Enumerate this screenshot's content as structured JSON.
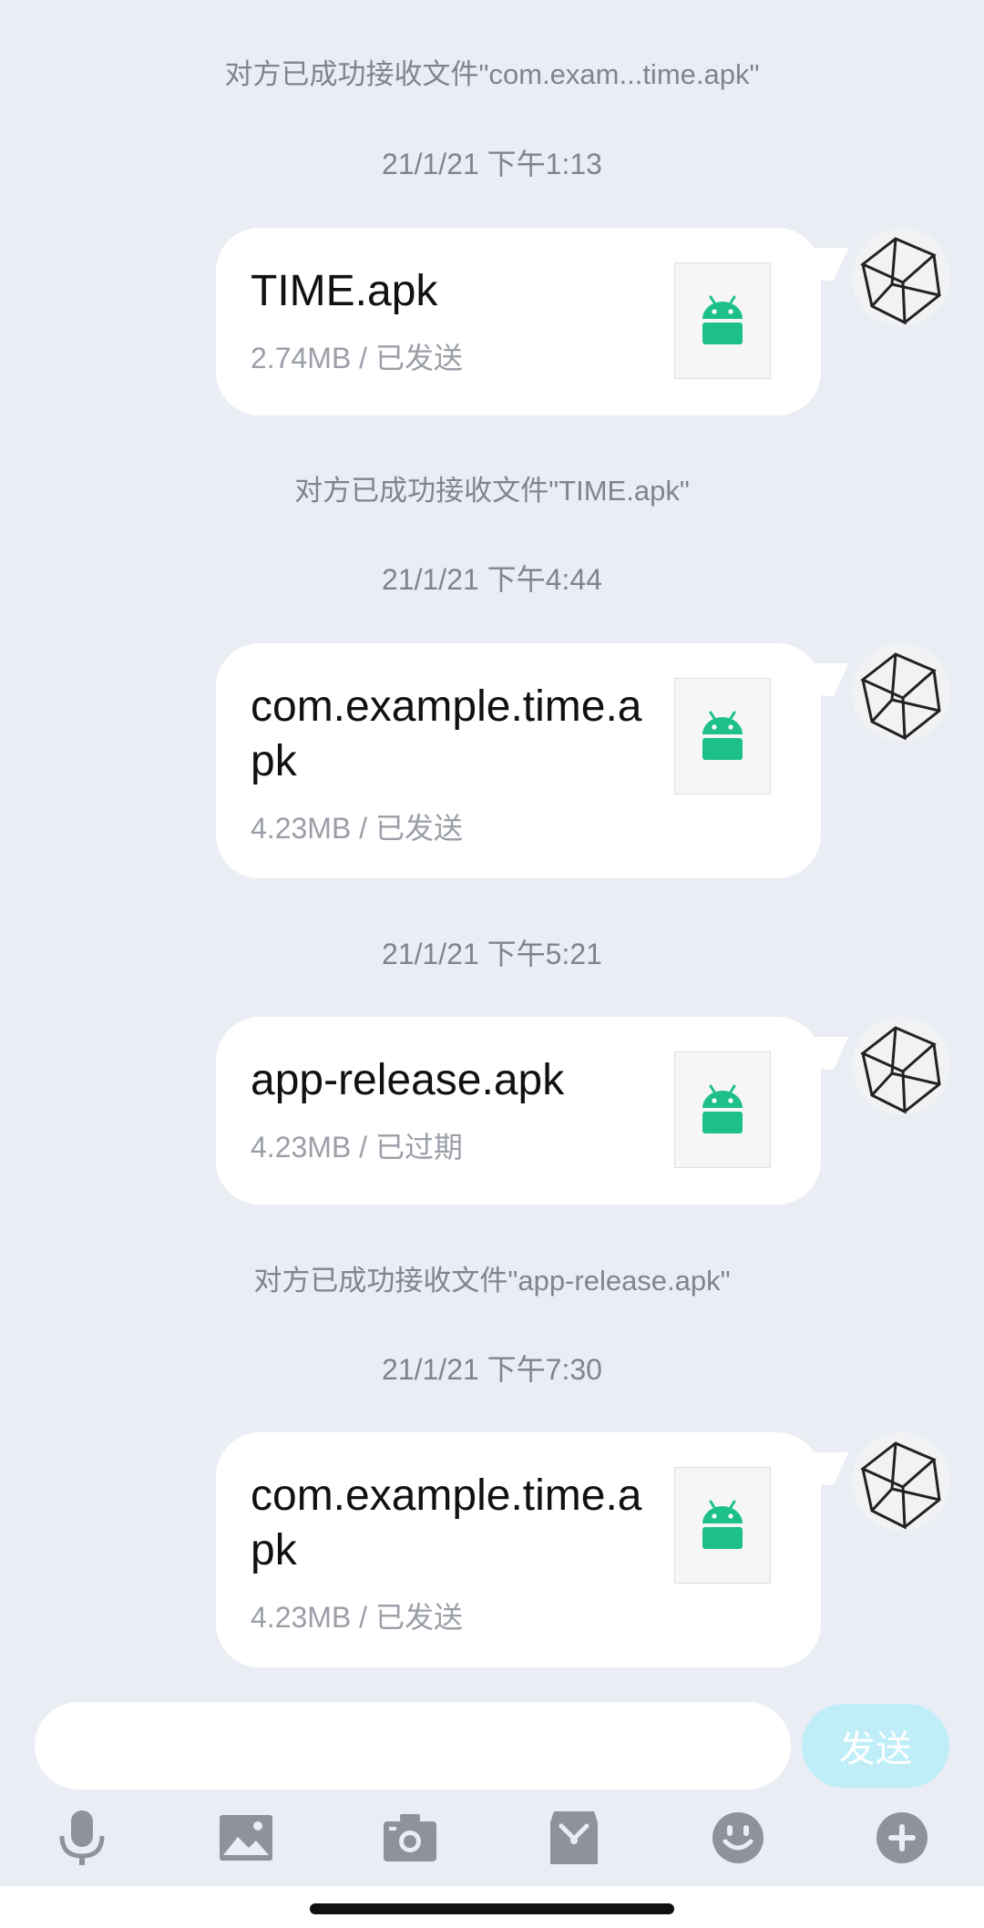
{
  "messages": {
    "notice_1": "对方已成功接收文件\"com.exam...time.apk\"",
    "time_1": "21/1/21 下午1:13",
    "file_1": {
      "name": "TIME.apk",
      "meta": "2.74MB / 已发送"
    },
    "notice_2": "对方已成功接收文件\"TIME.apk\"",
    "time_2": "21/1/21 下午4:44",
    "file_2": {
      "name": "com.example.time.apk",
      "meta": "4.23MB / 已发送"
    },
    "time_3": "21/1/21 下午5:21",
    "file_3": {
      "name": "app-release.apk",
      "meta": "4.23MB / 已过期"
    },
    "notice_3": "对方已成功接收文件\"app-release.apk\"",
    "time_4": "21/1/21 下午7:30",
    "file_4": {
      "name": "com.example.time.apk",
      "meta": "4.23MB / 已发送"
    }
  },
  "composer": {
    "input_value": "",
    "send_label": "发送"
  },
  "toolbar": {
    "icons": [
      "microphone-icon",
      "image-icon",
      "camera-icon",
      "file-transfer-icon",
      "emoji-icon",
      "plus-icon"
    ]
  },
  "colors": {
    "background": "#eaedf4",
    "android_green": "#1dc08b",
    "send_button": "#bfeef8",
    "toolbar_icon": "#8d929c"
  }
}
